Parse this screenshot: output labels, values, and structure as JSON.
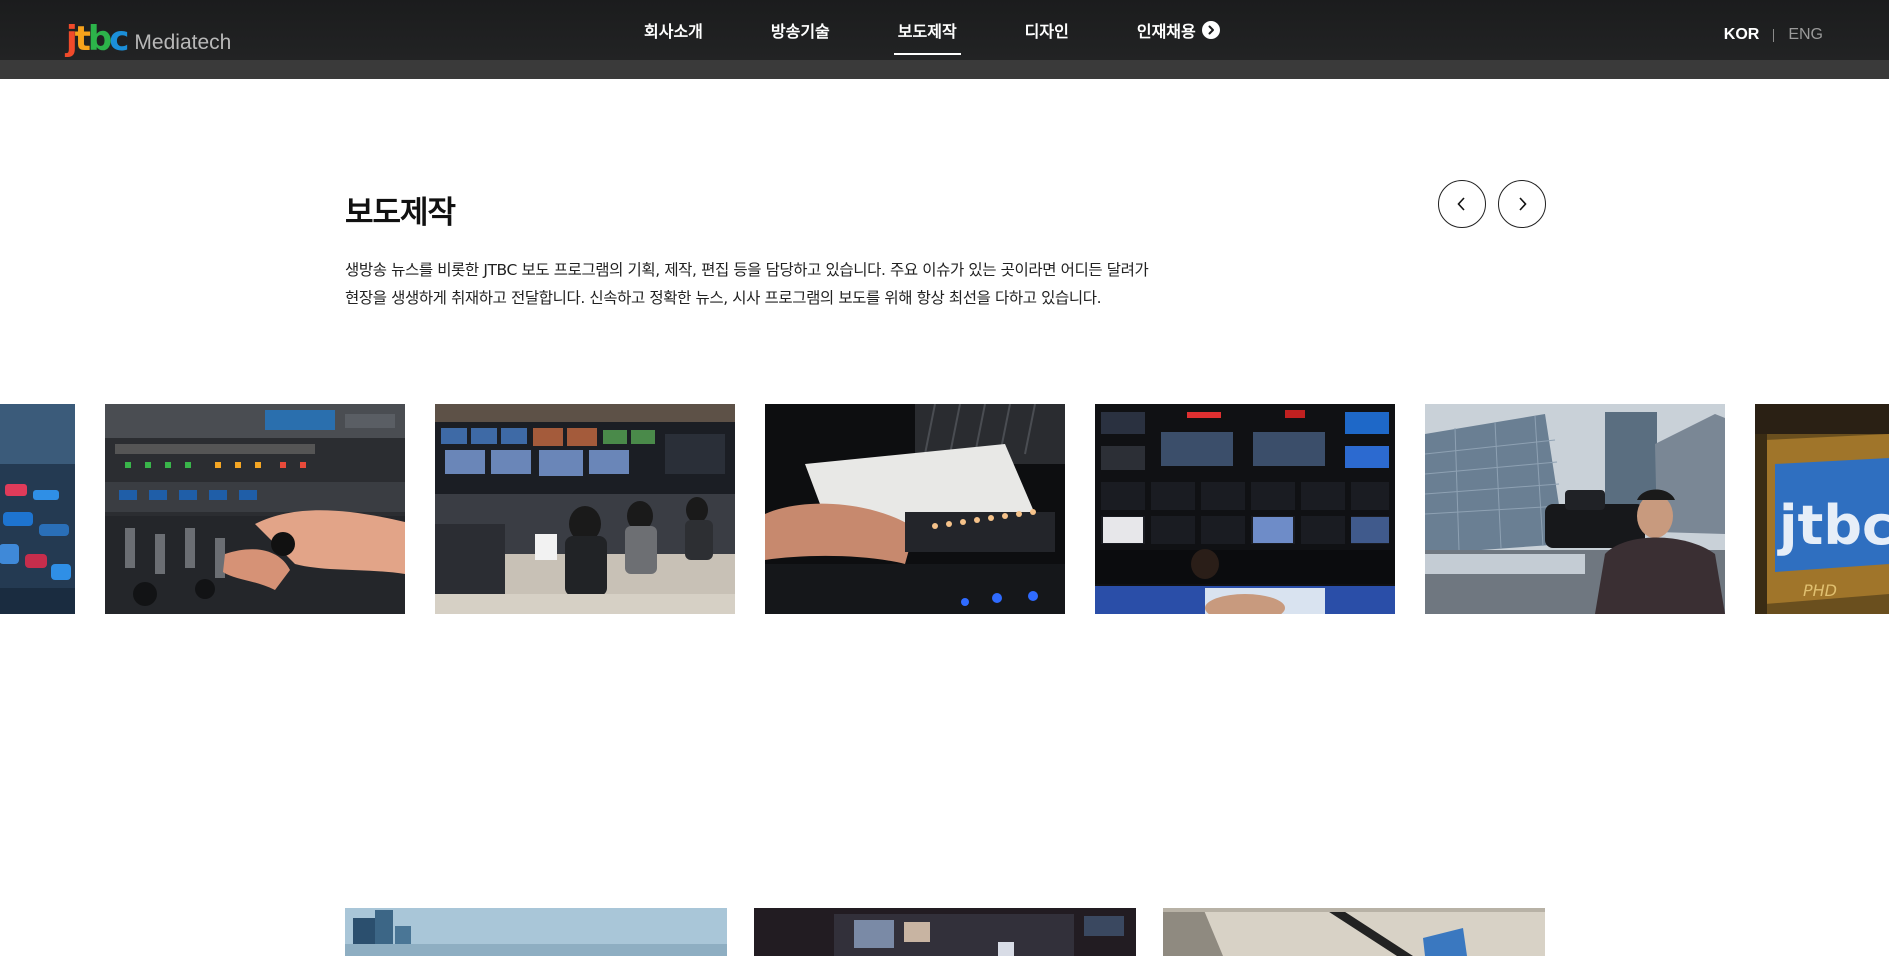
{
  "header": {
    "logo_mark": "jtbc",
    "logo_text": "Mediatech",
    "nav": [
      {
        "label": "회사소개",
        "active": false
      },
      {
        "label": "방송기술",
        "active": false
      },
      {
        "label": "보도제작",
        "active": true
      },
      {
        "label": "디자인",
        "active": false
      },
      {
        "label": "인재채용",
        "active": false,
        "icon": "circle-arrow-right-icon"
      }
    ],
    "lang": {
      "kor": "KOR",
      "eng": "ENG",
      "selected": "KOR"
    }
  },
  "section": {
    "title": "보도제작",
    "description_lines": [
      "생방송 뉴스를 비롯한 JTBC 보도 프로그램의 기획, 제작, 편집 등을 담당하고 있습니다. 주요 이슈가 있는 곳이라면 어디든 달려가",
      "현장을 생생하게 취재하고 전달합니다. 신속하고 정확한 뉴스, 시사 프로그램의 보도를 위해 항상 최선을 다하고 있습니다."
    ],
    "prev_icon": "chevron-left-icon",
    "next_icon": "chevron-right-icon"
  },
  "carousel": {
    "slides": [
      {
        "subject": "mixing-console-closeup"
      },
      {
        "subject": "audio-mixer-hands"
      },
      {
        "subject": "control-room-operators"
      },
      {
        "subject": "console-fader-hand"
      },
      {
        "subject": "multiview-monitor-wall"
      },
      {
        "subject": "camera-operator-outdoor"
      },
      {
        "subject": "jtbc-broadcast-van"
      }
    ]
  },
  "grid": {
    "tiles": [
      {
        "subject": "city-building-sky"
      },
      {
        "subject": "studio-monitors"
      },
      {
        "subject": "interior-glass-flag"
      }
    ]
  },
  "colors": {
    "header_bg": "#1b1c1d",
    "header_band": "#3a3a3a",
    "logo_j": "#f04a2a",
    "logo_t": "#f7a21b",
    "logo_b": "#2cb34a",
    "logo_c": "#1b8fd9"
  }
}
